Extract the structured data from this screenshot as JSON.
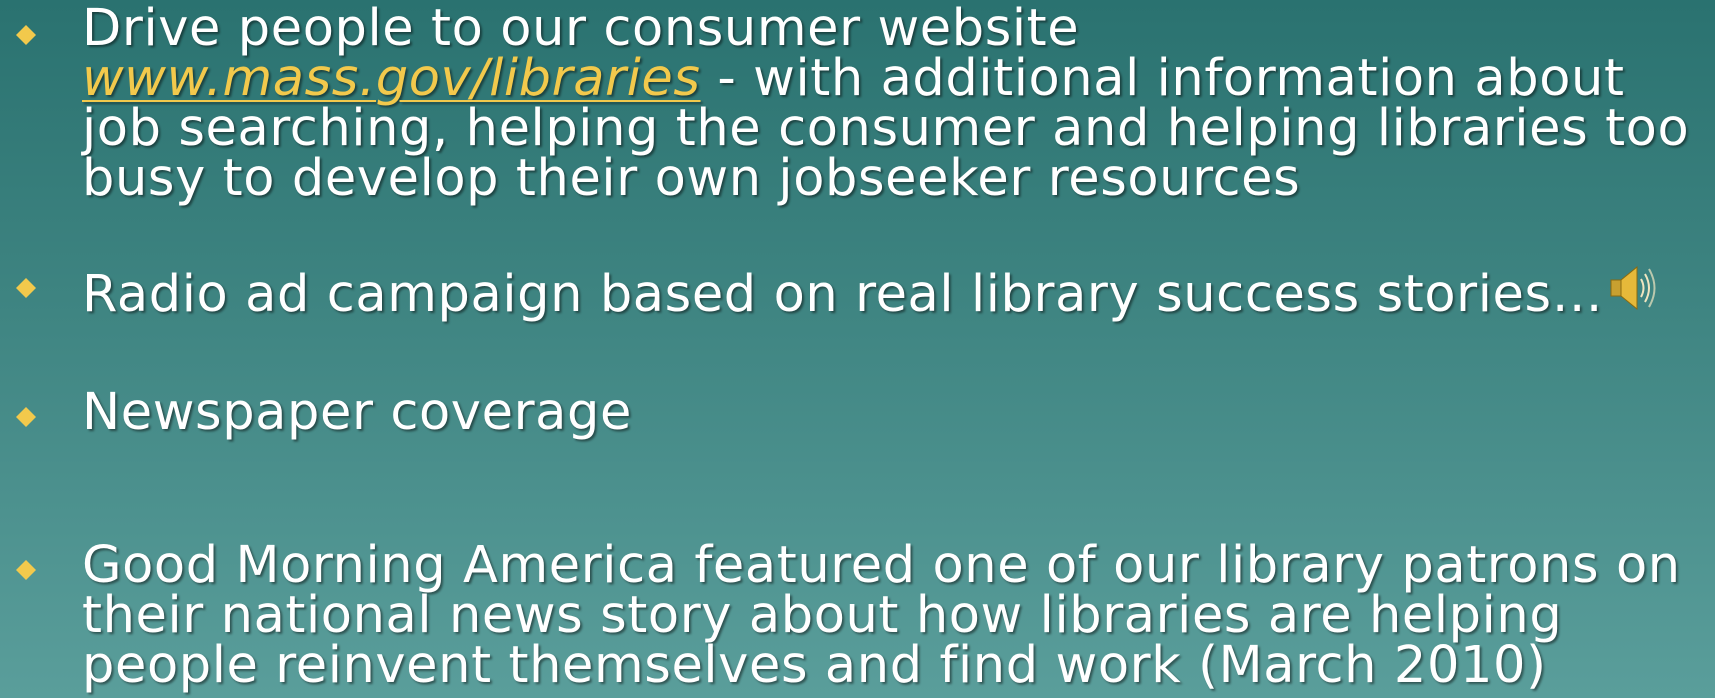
{
  "colors": {
    "background_top": "#2a7270",
    "background_bottom": "#5a9e9b",
    "bullet": "#f2c94c",
    "link": "#f2c94c",
    "text": "#ffffff"
  },
  "bullets": [
    {
      "icon": "diamond-bullet-icon",
      "line1": "Drive people to our consumer website",
      "link_text": "www.mass.gov/libraries",
      "after_link": " -  with additional information about job searching, helping the consumer and helping libraries too busy to develop their own jobseeker resources"
    },
    {
      "icon": "diamond-bullet-icon",
      "text": "Radio ad campaign based on real library success stories…",
      "trailing_icon": "speaker-icon"
    },
    {
      "icon": "diamond-bullet-icon",
      "text": "Newspaper coverage"
    },
    {
      "icon": "diamond-bullet-icon",
      "text": "Good Morning America featured one of our library patrons on their national news story about how libraries are helping people reinvent themselves and find work (March 2010)"
    }
  ]
}
